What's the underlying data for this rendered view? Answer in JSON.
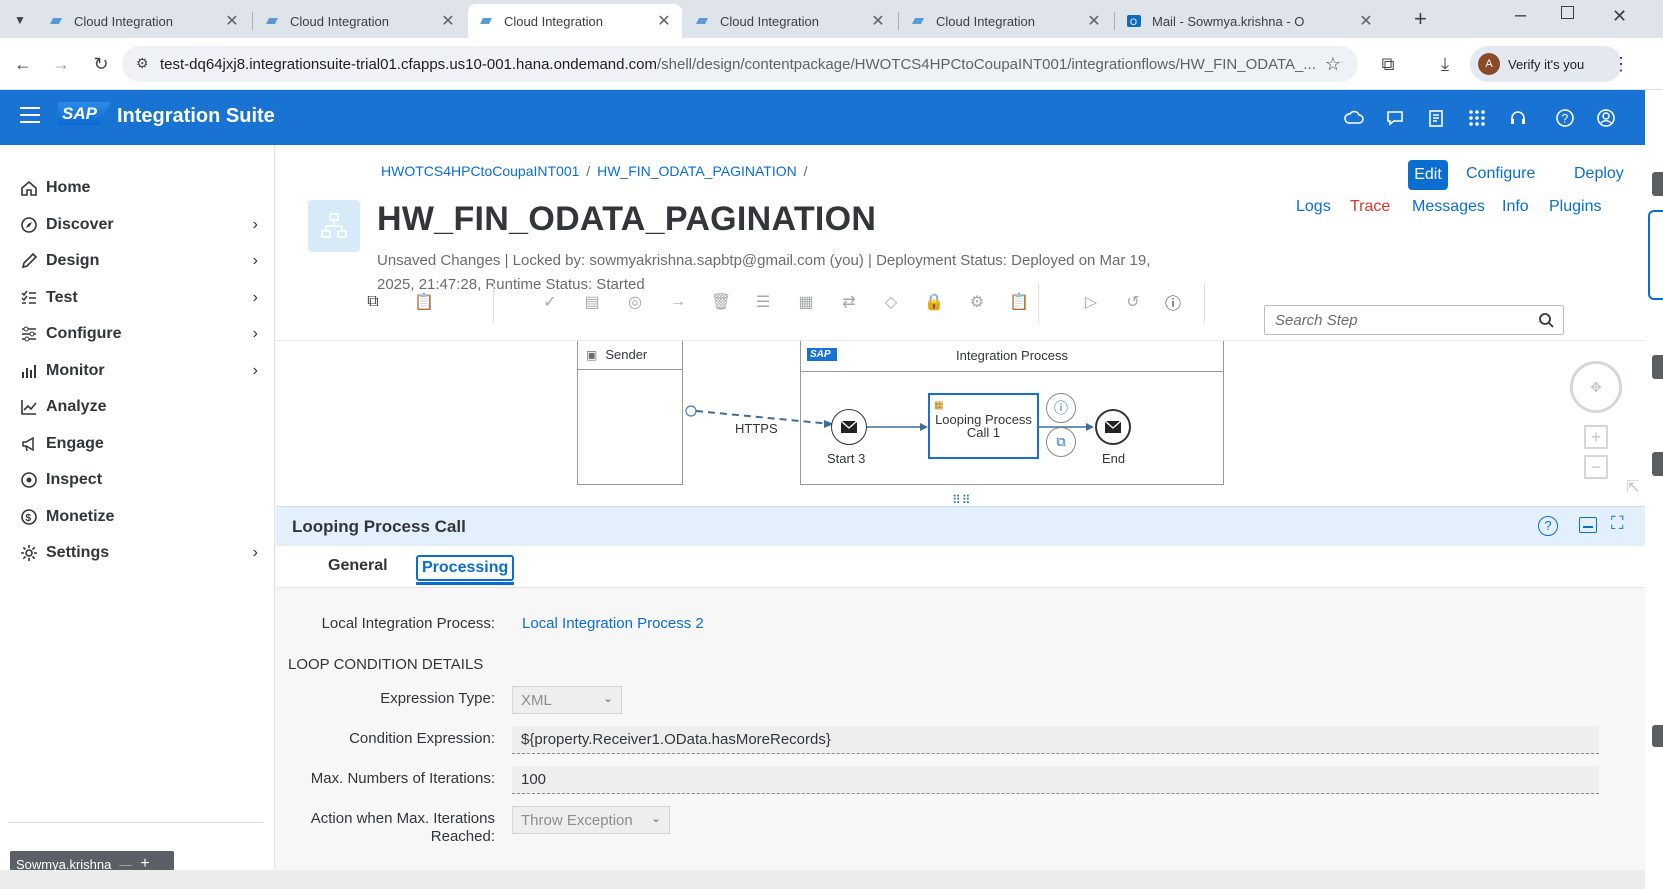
{
  "browser": {
    "tabs": [
      {
        "label": "Cloud Integration",
        "active": false
      },
      {
        "label": "Cloud Integration",
        "active": false
      },
      {
        "label": "Cloud Integration",
        "active": true
      },
      {
        "label": "Cloud Integration",
        "active": false
      },
      {
        "label": "Cloud Integration",
        "active": false
      },
      {
        "label": "Mail - Sowmya.krishna - O",
        "active": false
      }
    ],
    "url_host": "test-dq64jxj8.integrationsuite-trial01.cfapps.us10-001.hana.ondemand.com",
    "url_path": "/shell/design/contentpackage/HWOTCS4HPCtoCoupaINT001/integrationflows/HW_FIN_ODATA_...",
    "verify_label": "Verify it's you",
    "avatar_letter": "A"
  },
  "shell": {
    "logo": "SAP",
    "title": "Integration Suite",
    "accent": "#1873d3"
  },
  "nav": {
    "items": [
      {
        "label": "Home",
        "icon": "home-icon",
        "chevron": false
      },
      {
        "label": "Discover",
        "icon": "compass-icon",
        "chevron": true
      },
      {
        "label": "Design",
        "icon": "pencil-icon",
        "chevron": true
      },
      {
        "label": "Test",
        "icon": "checklist-icon",
        "chevron": true
      },
      {
        "label": "Configure",
        "icon": "sliders-icon",
        "chevron": true
      },
      {
        "label": "Monitor",
        "icon": "bar-chart-icon",
        "chevron": true
      },
      {
        "label": "Analyze",
        "icon": "line-chart-icon",
        "chevron": false
      },
      {
        "label": "Engage",
        "icon": "megaphone-icon",
        "chevron": false
      },
      {
        "label": "Inspect",
        "icon": "inspect-icon",
        "chevron": false
      },
      {
        "label": "Monetize",
        "icon": "dollar-icon",
        "chevron": false
      },
      {
        "label": "Settings",
        "icon": "gear-icon",
        "chevron": true
      }
    ],
    "user_chip": "Sowmya.krishna"
  },
  "header": {
    "breadcrumb": {
      "package": "HWOTCS4HPCtoCoupaINT001",
      "flow": "HW_FIN_ODATA_PAGINATION",
      "sep": "/"
    },
    "title": "HW_FIN_ODATA_PAGINATION",
    "status_line": "Unsaved Changes | Locked by: sowmyakrishna.sapbtp@gmail.com (you) | Deployment Status: Deployed on Mar 19, 2025, 21:47:28, Runtime Status: Started",
    "actions_row1": {
      "edit": "Edit",
      "configure": "Configure",
      "deploy": "Deploy"
    },
    "actions_row2": {
      "logs": "Logs",
      "trace": "Trace",
      "messages": "Messages",
      "info": "Info",
      "plugins": "Plugins"
    },
    "search_placeholder": "Search Step"
  },
  "diagram": {
    "sender_label": "Sender",
    "process_label": "Integration Process",
    "connection_label": "HTTPS",
    "start_label": "Start 3",
    "step_label": "Looping Process Call 1",
    "end_label": "End"
  },
  "properties": {
    "title": "Looping Process Call",
    "tabs": [
      {
        "label": "General"
      },
      {
        "label": "Processing"
      }
    ],
    "local_process_label": "Local Integration Process:",
    "local_process_value": "Local Integration Process 2",
    "section_title": "LOOP CONDITION DETAILS",
    "expr_type_label": "Expression Type:",
    "expr_type_value": "XML",
    "condition_label": "Condition Expression:",
    "condition_value": "${property.Receiver1.OData.hasMoreRecords}",
    "max_iter_label": "Max. Numbers of Iterations:",
    "max_iter_value": "100",
    "action_label_1": "Action when Max. Iterations",
    "action_label_2": "Reached:",
    "action_value": "Throw Exception"
  }
}
